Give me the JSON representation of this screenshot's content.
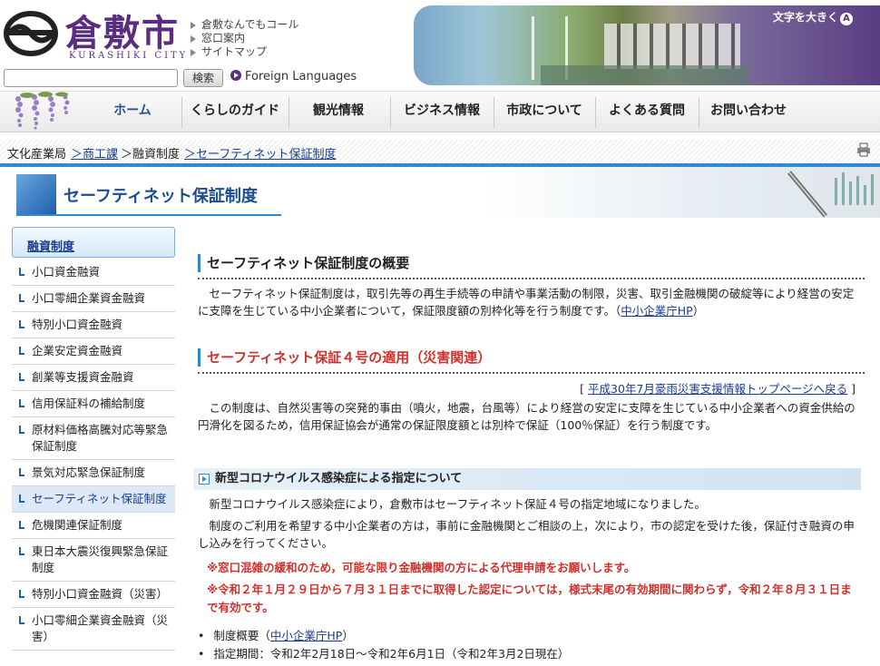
{
  "header": {
    "logo_text": "倉敷市",
    "logo_sub": "KURASHIKI CITY",
    "links": [
      "倉敷なんでもコール",
      "窓口案内",
      "サイトマップ"
    ],
    "search_placeholder": "",
    "search_button": "検索",
    "foreign_languages": "Foreign Languages",
    "font_size_label": "文字を大きく",
    "font_size_icon_letter": "A"
  },
  "nav": {
    "items": [
      "ホーム",
      "くらしのガイド",
      "観光情報",
      "ビジネス情報",
      "市政について",
      "よくある質問",
      "お問い合わせ"
    ]
  },
  "breadcrumb": {
    "items": [
      "文化産業局",
      "＞商工課",
      "＞融資制度",
      "＞セーフティネット保証制度"
    ]
  },
  "page_title": "セーフティネット保証制度",
  "sidebar": {
    "header": "融資制度",
    "items": [
      "小口資金融資",
      "小口零細企業資金融資",
      "特別小口資金融資",
      "企業安定資金融資",
      "創業等支援資金融資",
      "信用保証料の補給制度",
      "原材料価格高騰対応等緊急保証制度",
      "景気対応緊急保証制度",
      "セーフティネット保証制度",
      "危機関連保証制度",
      "東日本大震災復興緊急保証制度",
      "特別小口資金融資（災害）",
      "小口零細企業資金融資（災害）"
    ]
  },
  "main": {
    "h2_overview": "セーフティネット保証制度の概要",
    "overview_text": "セーフティネット保証制度は，取引先等の再生手続等の申請や事業活動の制限，災害、取引金融機関の破綻等により経営の安定に支障を生じている中小企業者について，保証限度額の別枠化等を行う制度です。（",
    "overview_link": "中小企業庁HP",
    "overview_close": "）",
    "h2_no4": "セーフティネット保証４号の適用（災害関連）",
    "top_link_open": "[ ",
    "top_link": "平成30年7月豪雨災害支援情報トップページへ戻る",
    "top_link_close": " ]",
    "no4_text": "この制度は、自然災害等の突発的事由（噴火，地震，台風等）により経営の安定に支障を生じている中小企業者への資金供給の円滑化を図るため，信用保証協会が通常の保証限度額とは別枠で保証（100％保証）を行う制度です。",
    "h3_corona": "新型コロナウイルス感染症による指定について",
    "corona_p1": "新型コロナウイルス感染症により，倉敷市はセーフティネット保証４号の指定地域になりました。",
    "corona_p2": "制度のご利用を希望する中小企業者の方は，事前に金融機関とご相談の上，次により，市の認定を受けた後，保証付き融資の申し込みを行ってください。",
    "red1": "※窓口混雑の緩和のため，可能な限り金融機関の方による代理申請をお願いします。",
    "red2": "※令和２年１月２９日から７月３１日までに取得した認定については，様式末尾の有効期間に関わらず，令和２年８月３１日まで有効です。",
    "bullet1_pre": "制度概要（",
    "bullet1_link": "中小企業庁HP",
    "bullet1_post": "）",
    "bullet2": "指定期間：令和2年2月18日～令和2年6月1日（令和2年3月2日現在）"
  }
}
